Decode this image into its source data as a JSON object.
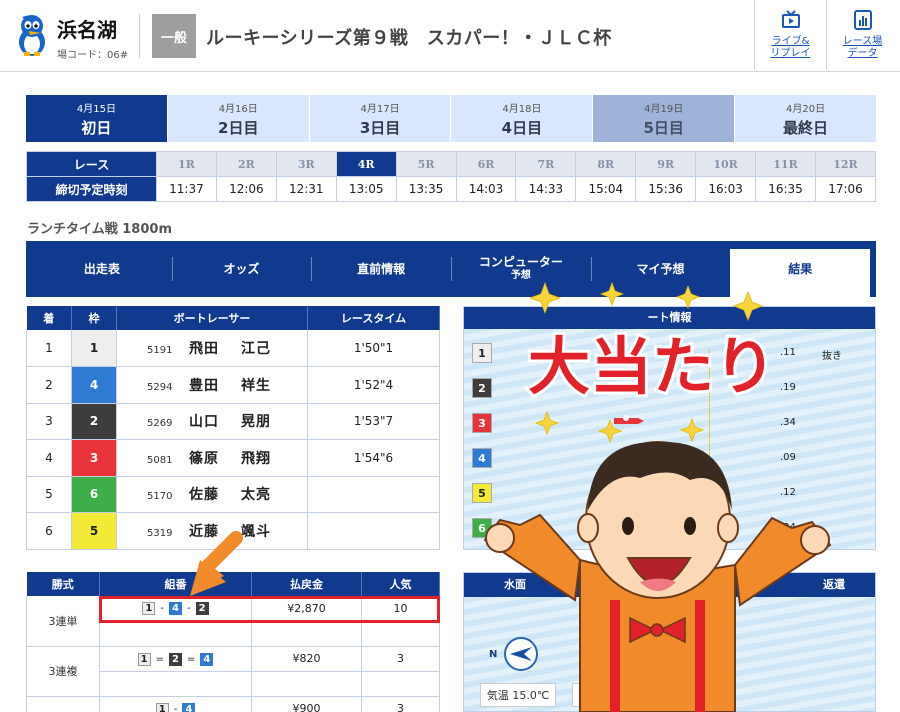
{
  "header": {
    "venue_name": "浜名湖",
    "venue_code": "場コード：06#",
    "grade": "一般",
    "race_title": "ルーキーシリーズ第９戦　スカパー！・ＪＬＣ杯",
    "links": [
      {
        "line1": "ライブ&",
        "line2": "リプレイ",
        "icon": "tv-icon"
      },
      {
        "line1": "レース場",
        "line2": "データ",
        "icon": "chart-icon"
      }
    ]
  },
  "days": [
    {
      "date": "4月15日",
      "label": "初日"
    },
    {
      "date": "4月16日",
      "label": "2日目"
    },
    {
      "date": "4月17日",
      "label": "3日目"
    },
    {
      "date": "4月18日",
      "label": "4日目"
    },
    {
      "date": "4月19日",
      "label": "5日目"
    },
    {
      "date": "4月20日",
      "label": "最終日"
    }
  ],
  "race_table": {
    "race_header": "レース",
    "deadline_header": "締切予定時刻",
    "races": [
      "1R",
      "2R",
      "3R",
      "4R",
      "5R",
      "6R",
      "7R",
      "8R",
      "9R",
      "10R",
      "11R",
      "12R"
    ],
    "times": [
      "11:37",
      "12:06",
      "12:31",
      "13:05",
      "13:35",
      "14:03",
      "14:33",
      "15:04",
      "15:36",
      "16:03",
      "16:35",
      "17:06"
    ]
  },
  "race_caption": "ランチタイム戦 1800m",
  "subnav": [
    {
      "label": "出走表"
    },
    {
      "label": "オッズ"
    },
    {
      "label": "直前情報"
    },
    {
      "label": "コンピューター",
      "sub": "予想"
    },
    {
      "label": "マイ予想"
    },
    {
      "label": "結果"
    }
  ],
  "results": {
    "headers": [
      "着",
      "枠",
      "ボートレーサー",
      "レースタイム"
    ],
    "rows": [
      {
        "place": "1",
        "frame": "1",
        "reg": "5191",
        "surname": "飛田",
        "given": "江己",
        "time": "1'50\"1"
      },
      {
        "place": "2",
        "frame": "4",
        "reg": "5294",
        "surname": "豊田",
        "given": "祥生",
        "time": "1'52\"4"
      },
      {
        "place": "3",
        "frame": "2",
        "reg": "5269",
        "surname": "山口",
        "given": "晃朋",
        "time": "1'53\"7"
      },
      {
        "place": "4",
        "frame": "3",
        "reg": "5081",
        "surname": "篠原",
        "given": "飛翔",
        "time": "1'54\"6"
      },
      {
        "place": "5",
        "frame": "6",
        "reg": "5170",
        "surname": "佐藤",
        "given": "太亮",
        "time": ""
      },
      {
        "place": "6",
        "frame": "5",
        "reg": "5319",
        "surname": "近藤",
        "given": "颯斗",
        "time": ""
      }
    ]
  },
  "start_info": {
    "title_fragment": "ート情報",
    "lanes": [
      {
        "lane": "1",
        "st": ".11",
        "note": "抜き"
      },
      {
        "lane": "2",
        "st": ".19",
        "note": ""
      },
      {
        "lane": "3",
        "st": ".34",
        "note": ""
      },
      {
        "lane": "4",
        "st": ".09",
        "note": ""
      },
      {
        "lane": "5",
        "st": ".12",
        "note": ""
      },
      {
        "lane": "6",
        "st": ".34",
        "note": ""
      }
    ]
  },
  "payouts": {
    "headers": [
      "勝式",
      "組番",
      "払戻金",
      "人気"
    ],
    "rows": [
      {
        "type": "3連単",
        "combo": [
          "1",
          "4",
          "2"
        ],
        "seps": [
          "-",
          "-"
        ],
        "amount": "¥2,870",
        "pop": "10"
      },
      {
        "type": "3連複",
        "combo": [
          "1",
          "2",
          "4"
        ],
        "seps": [
          "=",
          "="
        ],
        "amount": "¥820",
        "pop": "3"
      },
      {
        "type": "",
        "combo": [
          "1",
          "4"
        ],
        "seps": [
          "-"
        ],
        "amount": "¥900",
        "pop": "3"
      }
    ]
  },
  "weather": {
    "title_left": "水面",
    "title_right": "返還",
    "compass_label": "N",
    "water_temp": "気温 15.0℃"
  },
  "overlay": {
    "banner_text": "大当たり"
  },
  "colors": {
    "navy": "#113a8f",
    "highlight_red": "#e2212b",
    "arrow_orange": "#f08a2a"
  }
}
